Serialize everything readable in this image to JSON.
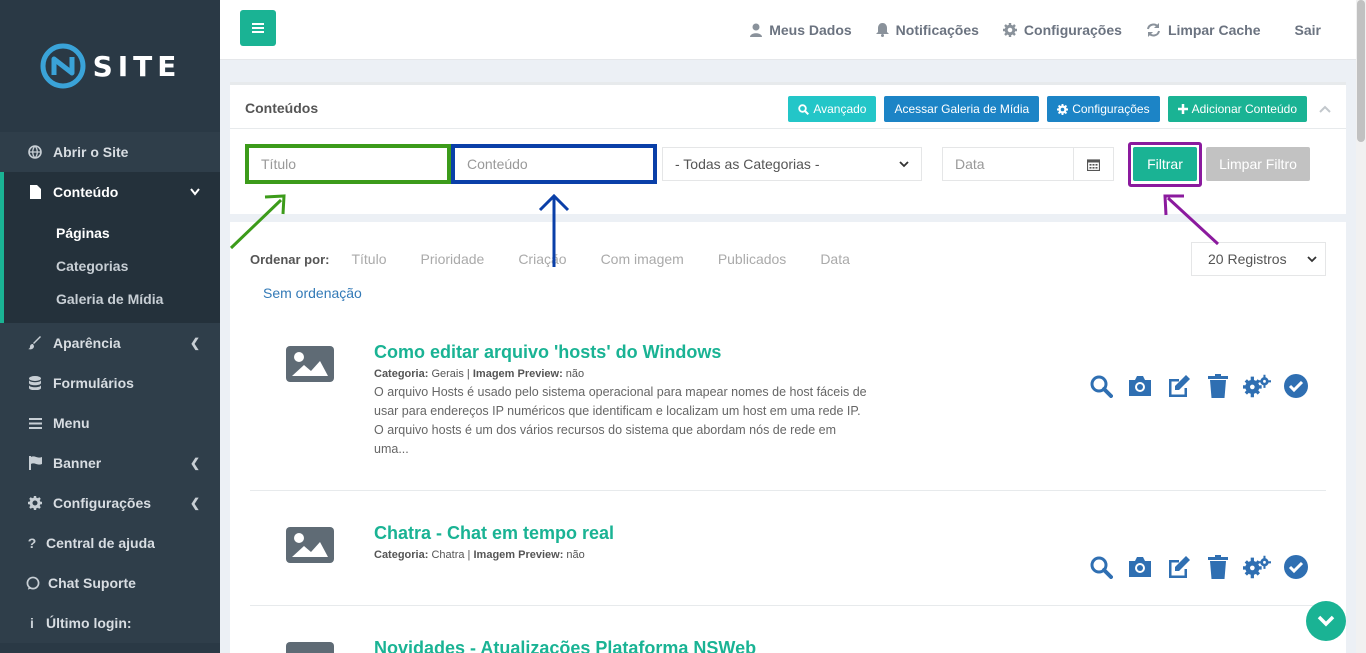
{
  "brand": {
    "logo_text": "SITE"
  },
  "sidebar": {
    "items": [
      {
        "label": "Abrir o Site"
      },
      {
        "label": "Conteúdo"
      },
      {
        "label": "Aparência"
      },
      {
        "label": "Formulários"
      },
      {
        "label": "Menu"
      },
      {
        "label": "Banner"
      },
      {
        "label": "Configurações"
      },
      {
        "label": "Central de ajuda"
      },
      {
        "label": "Chat Suporte"
      },
      {
        "label": "Último login:"
      }
    ],
    "sub_items": [
      {
        "label": "Páginas"
      },
      {
        "label": "Categorias"
      },
      {
        "label": "Galeria de Mídia"
      }
    ]
  },
  "topbar": {
    "links": [
      "Meus Dados",
      "Notificações",
      "Configurações",
      "Limpar Cache",
      "Sair"
    ]
  },
  "panel": {
    "title": "Conteúdos",
    "buttons": {
      "advanced": "Avançado",
      "gallery": "Acessar Galeria de Mídia",
      "settings": "Configurações",
      "add": "Adicionar Conteúdo"
    }
  },
  "filters": {
    "title_placeholder": "Título",
    "content_placeholder": "Conteúdo",
    "category_selected": "- Todas as Categorias -",
    "date_placeholder": "Data",
    "filter_button": "Filtrar",
    "clear_button": "Limpar Filtro"
  },
  "sort": {
    "label": "Ordenar por:",
    "options": [
      "Título",
      "Prioridade",
      "Criação",
      "Com imagem",
      "Publicados",
      "Data"
    ],
    "none": "Sem ordenação",
    "records_selected": "20 Registros"
  },
  "items": [
    {
      "title": "Como editar arquivo 'hosts' do Windows",
      "category_label": "Categoria:",
      "category": "Gerais",
      "preview_label": "Imagem Preview:",
      "preview": "não",
      "description": "O arquivo Hosts é usado pelo sistema operacional para mapear nomes de host fáceis de usar para endereços IP numéricos que identificam e localizam um host em uma rede IP. O arquivo hosts é um dos vários recursos do sistema que abordam nós de rede em uma..."
    },
    {
      "title": "Chatra - Chat em tempo real",
      "category_label": "Categoria:",
      "category": "Chatra",
      "preview_label": "Imagem Preview:",
      "preview": "não",
      "description": ""
    },
    {
      "title": "Novidades - Atualizações Plataforma NSWeb"
    }
  ],
  "colors": {
    "accent": "#1ab394",
    "sidebar": "#2a3945",
    "action_icons": "#2f6fb2",
    "highlight_green": "#3c9b1a",
    "highlight_blue": "#0a3fa8",
    "highlight_purple": "#8b1a9e"
  }
}
